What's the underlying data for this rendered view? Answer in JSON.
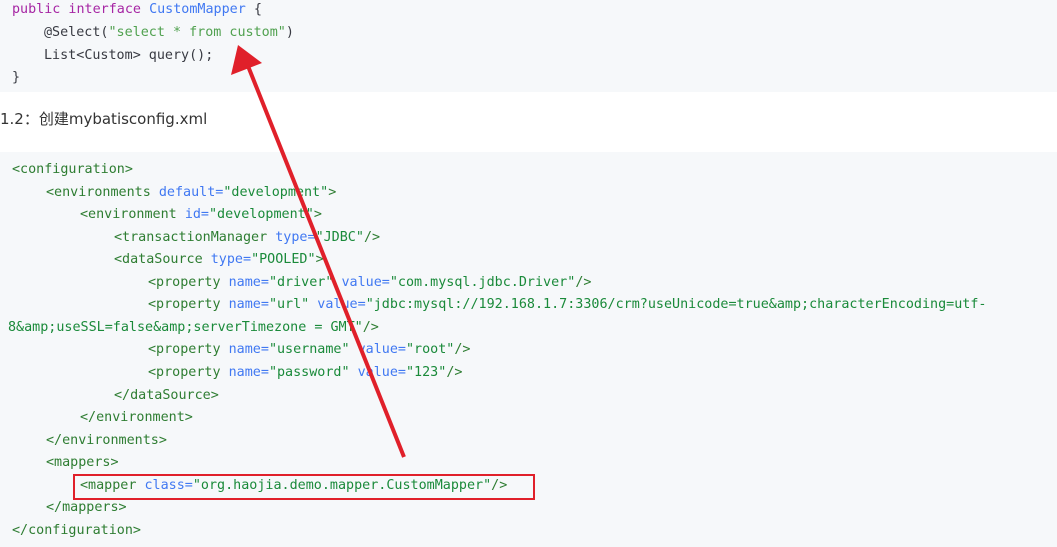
{
  "java_code": {
    "l1": {
      "kw": "public interface ",
      "name": "CustomMapper",
      "rest": " {"
    },
    "l2": {
      "anno": "@Select(",
      "str": "\"select * from custom\"",
      "rest": ")"
    },
    "l3": {
      "type1": "List",
      "lt": "<",
      "type2": "Custom",
      "gt": ">",
      "rest": " query();"
    },
    "l4": "}"
  },
  "heading": "1.2：创建mybatisconfig.xml",
  "xml_code": {
    "l1": "<configuration>",
    "l2": {
      "open": "<environments ",
      "attr": "default=",
      "val": "\"development\"",
      "close": ">"
    },
    "l3": {
      "open": "<environment ",
      "attr": "id=",
      "val": "\"development\"",
      "close": ">"
    },
    "l4": {
      "open": "<transactionManager ",
      "attr": "type=",
      "val": "\"JDBC\"",
      "close": "/>"
    },
    "l5": {
      "open": "<dataSource ",
      "attr": "type=",
      "val": "\"POOLED\"",
      "close": ">"
    },
    "l6": {
      "open": "<property ",
      "a1": "name=",
      "v1": "\"driver\"",
      "a2": " value=",
      "v2": "\"com.mysql.jdbc.Driver\"",
      "close": "/>"
    },
    "l7": {
      "open": "<property ",
      "a1": "name=",
      "v1": "\"url\"",
      "a2": " value=",
      "v2": "\"jdbc:mysql://192.168.1.7:3306/crm?useUnicode=true&amp;characterEncoding=utf-"
    },
    "l8": {
      "v2": "8&amp;useSSL=false&amp;serverTimezone = GMT\"",
      "close": "/>"
    },
    "l9": {
      "open": "<property ",
      "a1": "name=",
      "v1": "\"username\"",
      "a2": " value=",
      "v2": "\"root\"",
      "close": "/>"
    },
    "l10": {
      "open": "<property ",
      "a1": "name=",
      "v1": "\"password\"",
      "a2": " value=",
      "v2": "\"123\"",
      "close": "/>"
    },
    "l11": "</dataSource>",
    "l12": "</environment>",
    "l13": "</environments>",
    "l14": "<mappers>",
    "l15": {
      "open": "<mapper ",
      "attr": "class=",
      "val": "\"org.haojia.demo.mapper.CustomMapper\"",
      "close": "/>"
    },
    "l16": "</mappers>",
    "l17": "</configuration>"
  },
  "annotation_color": "#e0202a"
}
